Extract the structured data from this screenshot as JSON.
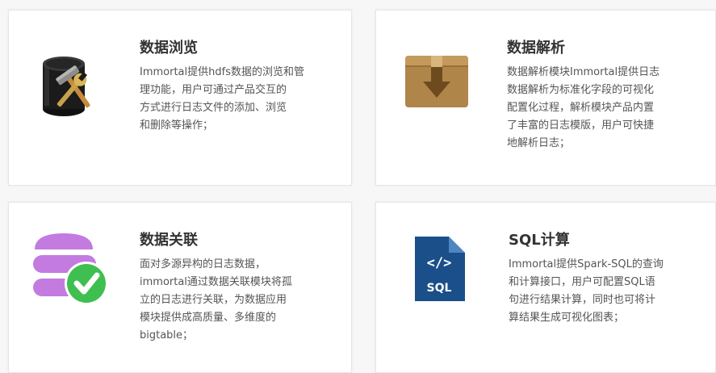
{
  "cards": [
    {
      "title": "数据浏览",
      "description": "Immortal提供hdfs数据的浏览和管\n理功能，用户可通过产品交互的\n方式进行日志文件的添加、浏览\n和删除等操作；",
      "icon": "database-tools-icon"
    },
    {
      "title": "数据解析",
      "description": "数据解析模块Immortal提供日志\n数据解析为标准化字段的可视化\n配置化过程，解析模块产品内置\n了丰富的日志模版，用户可快捷\n地解析日志；",
      "icon": "package-install-icon"
    },
    {
      "title": "数据关联",
      "description": "面对多源异构的日志数据，\nimmortal通过数据关联模块将孤\n立的日志进行关联，为数据应用\n模块提供成高质量、多维度的\nbigtable；",
      "icon": "stack-check-icon"
    },
    {
      "title": "SQL计算",
      "description": "Immortal提供Spark-SQL的查询\n和计算接口，用户可配置SQL语\n句进行结果计算，同时也可将计\n算结果生成可视化图表；",
      "icon": "sql-file-icon",
      "icon_label": "SQL"
    }
  ],
  "colors": {
    "title": "#333333",
    "text": "#555555",
    "card_bg": "#ffffff",
    "page_bg": "#f7f7f7",
    "purple": "#c37be0",
    "green": "#3fbf4f",
    "sql_blue": "#1a4f8a",
    "box_brown": "#b0854a"
  }
}
